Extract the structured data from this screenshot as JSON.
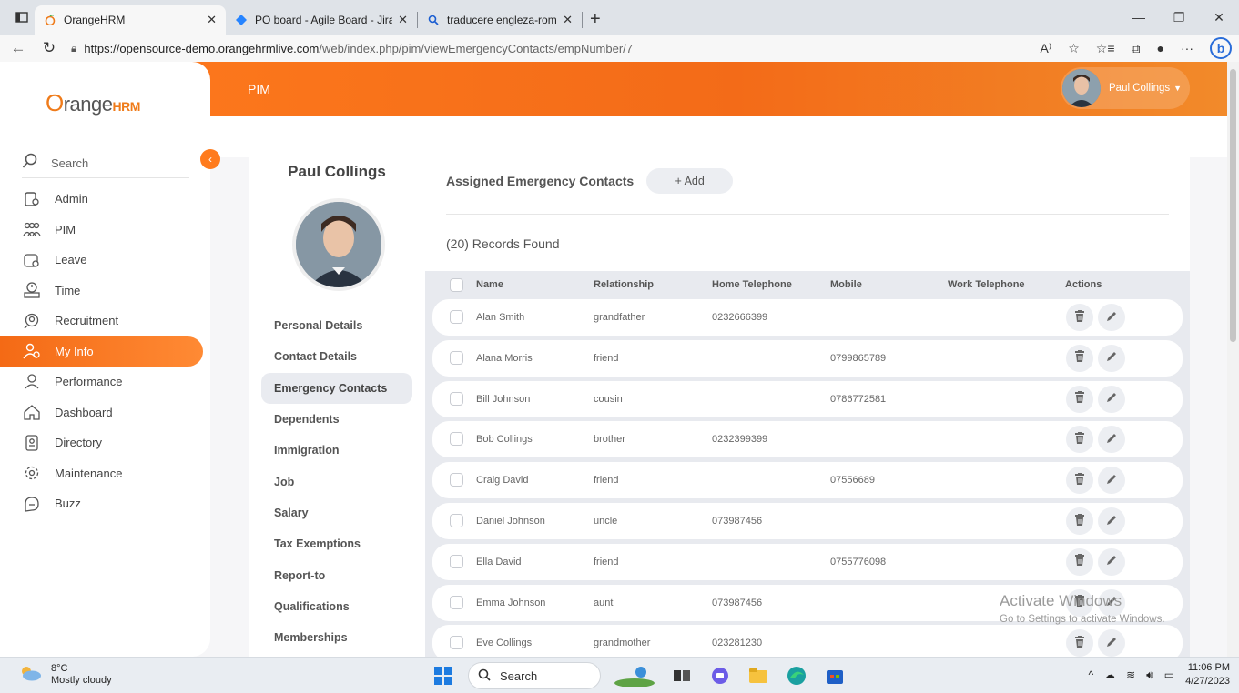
{
  "browser": {
    "tabs": [
      {
        "label": "OrangeHRM",
        "active": true
      },
      {
        "label": "PO board - Agile Board - Jira",
        "active": false
      },
      {
        "label": "traducere engleza-romana - Sear",
        "active": false
      }
    ],
    "url_host": "https://opensource-demo.orangehrmlive.com",
    "url_path": "/web/index.php/pim/viewEmergencyContacts/empNumber/7"
  },
  "app": {
    "brand_o": "O",
    "brand_range": "range",
    "brand_hrm": "HRM",
    "module_title": "PIM",
    "user_name": "Paul Collings",
    "search_label": "Search",
    "nav": [
      {
        "label": "Admin",
        "icon": "admin-icon"
      },
      {
        "label": "PIM",
        "icon": "pim-icon"
      },
      {
        "label": "Leave",
        "icon": "leave-icon"
      },
      {
        "label": "Time",
        "icon": "time-icon"
      },
      {
        "label": "Recruitment",
        "icon": "recruitment-icon"
      },
      {
        "label": "My Info",
        "icon": "myinfo-icon",
        "active": true
      },
      {
        "label": "Performance",
        "icon": "performance-icon"
      },
      {
        "label": "Dashboard",
        "icon": "dashboard-icon"
      },
      {
        "label": "Directory",
        "icon": "directory-icon"
      },
      {
        "label": "Maintenance",
        "icon": "maintenance-icon"
      },
      {
        "label": "Buzz",
        "icon": "buzz-icon"
      }
    ],
    "accent": "#ff7b1d"
  },
  "profile": {
    "name": "Paul Collings",
    "menu": [
      "Personal Details",
      "Contact Details",
      "Emergency Contacts",
      "Dependents",
      "Immigration",
      "Job",
      "Salary",
      "Tax Exemptions",
      "Report-to",
      "Qualifications",
      "Memberships"
    ],
    "active_menu": "Emergency Contacts"
  },
  "contacts": {
    "title": "Assigned Emergency Contacts",
    "add_label": "+ Add",
    "records_found": "(20) Records Found",
    "columns": [
      "Name",
      "Relationship",
      "Home Telephone",
      "Mobile",
      "Work Telephone",
      "Actions"
    ],
    "rows": [
      {
        "name": "Alan Smith",
        "relationship": "grandfather",
        "home": "0232666399",
        "mobile": "",
        "work": ""
      },
      {
        "name": "Alana Morris",
        "relationship": "friend",
        "home": "",
        "mobile": "0799865789",
        "work": ""
      },
      {
        "name": "Bill Johnson",
        "relationship": "cousin",
        "home": "",
        "mobile": "0786772581",
        "work": ""
      },
      {
        "name": "Bob Collings",
        "relationship": "brother",
        "home": "0232399399",
        "mobile": "",
        "work": ""
      },
      {
        "name": "Craig David",
        "relationship": "friend",
        "home": "",
        "mobile": "07556689",
        "work": ""
      },
      {
        "name": "Daniel Johnson",
        "relationship": "uncle",
        "home": "073987456",
        "mobile": "",
        "work": ""
      },
      {
        "name": "Ella David",
        "relationship": "friend",
        "home": "",
        "mobile": "0755776098",
        "work": ""
      },
      {
        "name": "Emma Johnson",
        "relationship": "aunt",
        "home": "073987456",
        "mobile": "",
        "work": ""
      },
      {
        "name": "Eve Collings",
        "relationship": "grandmother",
        "home": "023281230",
        "mobile": "",
        "work": ""
      }
    ]
  },
  "watermark": {
    "line1": "Activate Windows",
    "line2": "Go to Settings to activate Windows."
  },
  "taskbar": {
    "temperature": "8°C",
    "weather": "Mostly cloudy",
    "search_label": "Search",
    "time": "11:06 PM",
    "date": "4/27/2023"
  }
}
